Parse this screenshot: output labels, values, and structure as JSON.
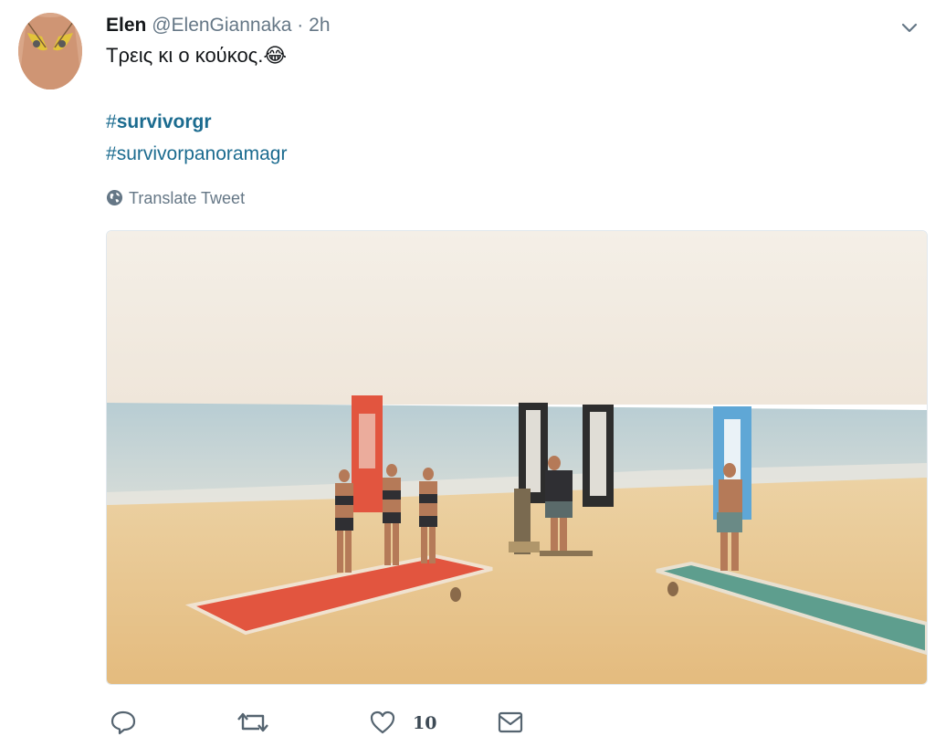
{
  "tweet": {
    "author_name": "Elen",
    "author_handle": "@ElenGiannaka",
    "separator": "·",
    "time": "2h",
    "text": "Τρεις κι ο κούκος.",
    "emoji": "😂",
    "hashtags": [
      {
        "hash": "#",
        "tag": "survivorgr"
      },
      {
        "hash": "#",
        "tag": "survivorpanoramagr"
      }
    ],
    "translate_label": "Translate Tweet",
    "like_count": "10"
  },
  "icons": {
    "menu": "chevron-down-icon",
    "translate": "globe-icon",
    "reply": "reply-icon",
    "retweet": "retweet-icon",
    "like": "heart-icon",
    "dm": "envelope-icon"
  },
  "colors": {
    "hashtag": "#1b6b8f",
    "secondary_text": "#657786",
    "sky": "#f2ebe0",
    "sea": "#b9cfd5",
    "sand": "#e8c48c",
    "red_team": "#e2553f",
    "blue_team": "#5fa7d6",
    "green_mat": "#5e9e8e"
  }
}
